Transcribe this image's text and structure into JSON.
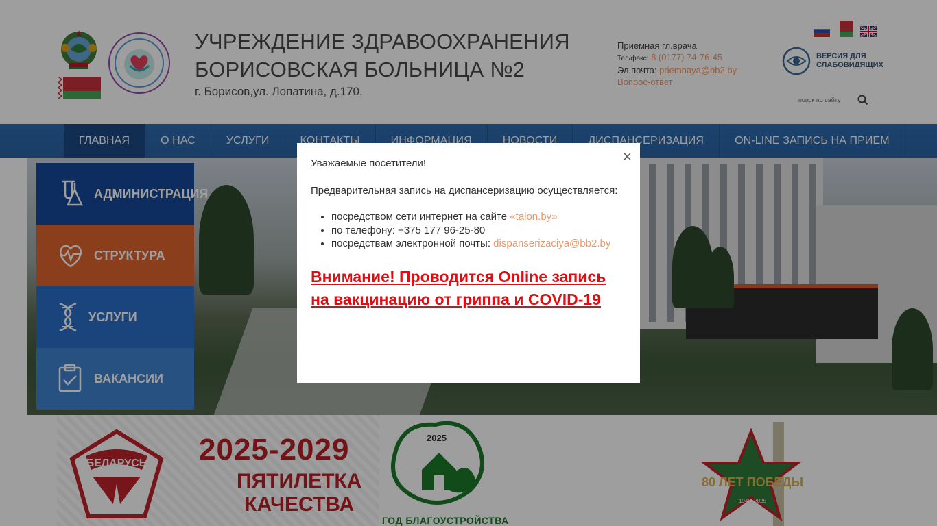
{
  "header": {
    "org_title": "УЧРЕЖДЕНИЕ ЗДРАВООХРАНЕНИЯ\nБОРИСОВСКАЯ БОЛЬНИЦА №2",
    "address": "г. Борисов,ул. Лопатина, д.170.",
    "contacts": {
      "reception_label": "Приемная гл.врача",
      "phone_label": "Тел/факс:",
      "phone": "8 (0177) 74-76-45",
      "email_label": "Эл.почта:",
      "email": "priemnaya@bb2.by",
      "faq": "Вопрос-ответ"
    },
    "vision_label": "ВЕРСИЯ ДЛЯ\nСЛАБОВИДЯЩИХ",
    "search_placeholder": "поиск по сайту",
    "langs": [
      "ru",
      "by",
      "en"
    ]
  },
  "nav": {
    "items": [
      "ГЛАВНАЯ",
      "О НАС",
      "УСЛУГИ",
      "КОНТАКТЫ",
      "ИНФОРМАЦИЯ",
      "НОВОСТИ",
      "ДИСПАНСЕРИЗАЦИЯ",
      "ON-LINE ЗАПИСЬ НА ПРИЕМ"
    ],
    "active": "ГЛАВНАЯ"
  },
  "side_menu": {
    "items": [
      "АДМИНИСТРАЦИЯ",
      "СТРУКТУРА",
      "УСЛУГИ",
      "ВАКАНСИИ"
    ],
    "icons": [
      "lab-flask-icon",
      "heart-pulse-icon",
      "dna-icon",
      "clipboard-check-icon"
    ]
  },
  "banners": {
    "b1_years": "2025-2029",
    "b1_text": "ПЯТИЛЕТКА\nКАЧЕСТВА",
    "b1_badge": "БЕЛАРУСЬ",
    "b2_year": "2025",
    "b2_caption": "ГОД БЛАГОУСТРОЙСТВА",
    "b3_text": "80 ЛЕТ ПОБЕДЫ",
    "b3_years": "1945–2025"
  },
  "modal": {
    "greeting": "Уважаемые посетители!",
    "intro": "Предварительная запись на диспансеризацию осуществляется:",
    "item1_text": "посредством сети интернет на сайте ",
    "item1_link": "«talon.by»",
    "item2_text": "по телефону: +375 177 96-25-80",
    "item3_text": "посредствам электронной почты: ",
    "item3_link": "dispanserizaciya@bb2.by",
    "alert": "Внимание! Проводится Online запись на вакцинацию от гриппа и COVID-19",
    "close_symbol": "×"
  },
  "colors": {
    "nav_blue": "#2e6db1",
    "accent_orange": "#f29564",
    "alert_red": "#e10d12"
  }
}
